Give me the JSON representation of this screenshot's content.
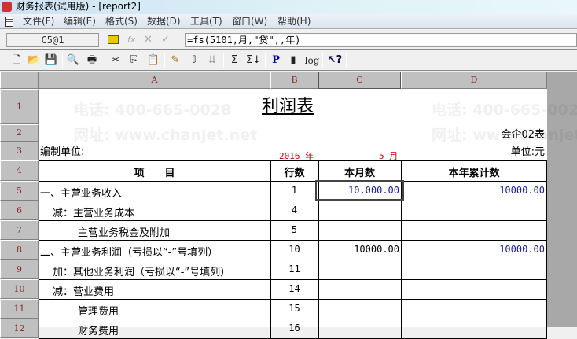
{
  "window": {
    "title": "财务报表(试用版) - [report2]"
  },
  "menu": [
    "文件(F)",
    "编辑(E)",
    "格式(S)",
    "数据(D)",
    "工具(T)",
    "窗口(W)",
    "帮助(H)"
  ],
  "formula_bar": {
    "cell_ref": "C5@1",
    "fx": "fx",
    "cancel": "✕",
    "confirm": "✓",
    "formula": "=fs(5101,月,\"贷\",,年)"
  },
  "toolbar": [
    {
      "icon": "new-file-icon",
      "glyph": "🗋"
    },
    {
      "icon": "open-folder-icon",
      "glyph": "📂"
    },
    {
      "icon": "save-icon",
      "glyph": "💾"
    },
    {
      "icon": "print-preview-icon",
      "glyph": "🔍"
    },
    {
      "icon": "print-icon",
      "glyph": "🖶"
    },
    {
      "icon": "cut-icon",
      "glyph": "✂"
    },
    {
      "icon": "copy-icon",
      "glyph": "⎘"
    },
    {
      "icon": "paste-icon",
      "glyph": "📋"
    },
    {
      "icon": "format-brush-icon",
      "glyph": "✎"
    },
    {
      "icon": "sort-asc-icon",
      "glyph": "⇩"
    },
    {
      "icon": "sort-desc-icon",
      "glyph": "⇊"
    },
    {
      "icon": "sum-icon",
      "glyph": "Σ"
    },
    {
      "icon": "sum-down-icon",
      "glyph": "Σ↓"
    },
    {
      "icon": "p-icon",
      "glyph": "P"
    },
    {
      "icon": "bookmark-icon",
      "glyph": "▮"
    },
    {
      "icon": "log-icon",
      "glyph": "log"
    },
    {
      "icon": "help-pointer-icon",
      "glyph": "↖?"
    }
  ],
  "columns": [
    "A",
    "B",
    "C",
    "D"
  ],
  "rows": [
    "1",
    "2",
    "3",
    "4",
    "5",
    "6",
    "7",
    "8",
    "9",
    "10",
    "11",
    "12"
  ],
  "report": {
    "title": "利润表",
    "form_no": "会企02表",
    "unit_label": "编制单位:",
    "year": "2016 年",
    "month": "5 月",
    "currency": "单位:元",
    "headers": [
      "项　　目",
      "行数",
      "本月数",
      "本年累计数"
    ],
    "lines": [
      {
        "item": "一、主营业务收入",
        "line": "1",
        "month": "10,000.00",
        "ytd": "10000.00",
        "indent": 0
      },
      {
        "item": "减：主营业务成本",
        "line": "4",
        "month": "",
        "ytd": "",
        "indent": 1
      },
      {
        "item": "主营业务税金及附加",
        "line": "5",
        "month": "",
        "ytd": "",
        "indent": 2
      },
      {
        "item": "二、主营业务利润（亏损以“-”号填列）",
        "line": "10",
        "month": "10000.00",
        "ytd": "10000.00",
        "indent": 0
      },
      {
        "item": "加：其他业务利润（亏损以“-”号填列）",
        "line": "11",
        "month": "",
        "ytd": "",
        "indent": 1
      },
      {
        "item": "减：营业费用",
        "line": "14",
        "month": "",
        "ytd": "",
        "indent": 1
      },
      {
        "item": "管理费用",
        "line": "15",
        "month": "",
        "ytd": "",
        "indent": 2
      },
      {
        "item": "财务费用",
        "line": "16",
        "month": "",
        "ytd": "",
        "indent": 2
      }
    ]
  },
  "watermark": {
    "phone": "电话: 400-665-0028",
    "site": "网址: www.chanjet.net"
  },
  "colors": {
    "blue_value": "#1a1aa0",
    "red_date": "#c00000"
  }
}
